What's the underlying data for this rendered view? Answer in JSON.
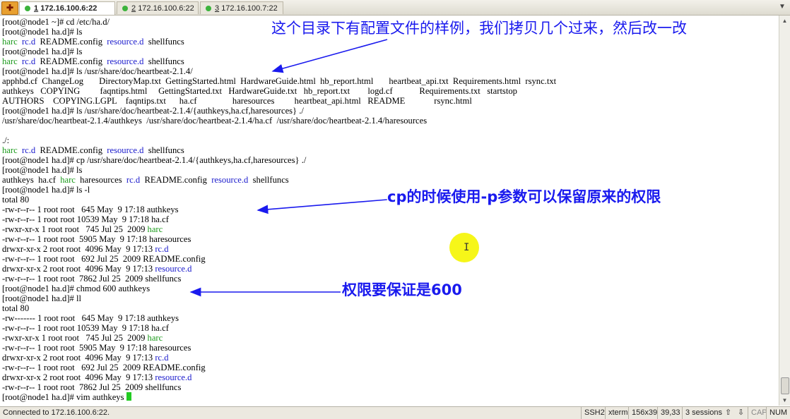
{
  "tabs": [
    {
      "num": "1",
      "host": "172.16.100.6:22"
    },
    {
      "num": "2",
      "host": "172.16.100.6:22"
    },
    {
      "num": "3",
      "host": "172.16.100.7:22"
    }
  ],
  "colors": {
    "executable": "#1a9a1a",
    "directory": "#1a1acc",
    "annotation": "#1a1aee",
    "cursor": "#22cc22",
    "highlight": "#f5f500"
  },
  "terminal_lines": [
    [
      {
        "t": "[root@node1 ~]# cd /etc/ha.d/"
      }
    ],
    [
      {
        "t": "[root@node1 ha.d]# ls"
      }
    ],
    [
      {
        "t": "harc",
        "c": "exec"
      },
      {
        "t": "  "
      },
      {
        "t": "rc.d",
        "c": "dir"
      },
      {
        "t": "  README.config  "
      },
      {
        "t": "resource.d",
        "c": "dir"
      },
      {
        "t": "  shellfuncs"
      }
    ],
    [
      {
        "t": "[root@node1 ha.d]# ls"
      }
    ],
    [
      {
        "t": "harc",
        "c": "exec"
      },
      {
        "t": "  "
      },
      {
        "t": "rc.d",
        "c": "dir"
      },
      {
        "t": "  README.config  "
      },
      {
        "t": "resource.d",
        "c": "dir"
      },
      {
        "t": "  shellfuncs"
      }
    ],
    [
      {
        "t": "[root@node1 ha.d]# ls /usr/share/doc/heartbeat-2.1.4/"
      }
    ],
    [
      {
        "t": "apphbd.cf  ChangeLog       DirectoryMap.txt  GettingStarted.html  HardwareGuide.html  hb_report.html       heartbeat_api.txt  Requirements.html  rsync.txt"
      }
    ],
    [
      {
        "t": "authkeys   COPYING         faqntips.html     GettingStarted.txt   HardwareGuide.txt   hb_report.txt        logd.cf            Requirements.txt   startstop"
      }
    ],
    [
      {
        "t": "AUTHORS    COPYING.LGPL    faqntips.txt      ha.cf                haresources         heartbeat_api.html   README             rsync.html"
      }
    ],
    [
      {
        "t": "[root@node1 ha.d]# ls /usr/share/doc/heartbeat-2.1.4/{authkeys,ha.cf,haresources} ./"
      }
    ],
    [
      {
        "t": "/usr/share/doc/heartbeat-2.1.4/authkeys  /usr/share/doc/heartbeat-2.1.4/ha.cf  /usr/share/doc/heartbeat-2.1.4/haresources"
      }
    ],
    [
      {
        "t": ""
      }
    ],
    [
      {
        "t": "./:"
      }
    ],
    [
      {
        "t": "harc",
        "c": "exec"
      },
      {
        "t": "  "
      },
      {
        "t": "rc.d",
        "c": "dir"
      },
      {
        "t": "  README.config  "
      },
      {
        "t": "resource.d",
        "c": "dir"
      },
      {
        "t": "  shellfuncs"
      }
    ],
    [
      {
        "t": "[root@node1 ha.d]# cp /usr/share/doc/heartbeat-2.1.4/{authkeys,ha.cf,haresources} ./"
      }
    ],
    [
      {
        "t": "[root@node1 ha.d]# ls"
      }
    ],
    [
      {
        "t": "authkeys  ha.cf  "
      },
      {
        "t": "harc",
        "c": "exec"
      },
      {
        "t": "  haresources  "
      },
      {
        "t": "rc.d",
        "c": "dir"
      },
      {
        "t": "  README.config  "
      },
      {
        "t": "resource.d",
        "c": "dir"
      },
      {
        "t": "  shellfuncs"
      }
    ],
    [
      {
        "t": "[root@node1 ha.d]# ls -l"
      }
    ],
    [
      {
        "t": "total 80"
      }
    ],
    [
      {
        "t": "-rw-r--r-- 1 root root   645 May  9 17:18 authkeys"
      }
    ],
    [
      {
        "t": "-rw-r--r-- 1 root root 10539 May  9 17:18 ha.cf"
      }
    ],
    [
      {
        "t": "-rwxr-xr-x 1 root root   745 Jul 25  2009 "
      },
      {
        "t": "harc",
        "c": "exec"
      }
    ],
    [
      {
        "t": "-rw-r--r-- 1 root root  5905 May  9 17:18 haresources"
      }
    ],
    [
      {
        "t": "drwxr-xr-x 2 root root  4096 May  9 17:13 "
      },
      {
        "t": "rc.d",
        "c": "dir"
      }
    ],
    [
      {
        "t": "-rw-r--r-- 1 root root   692 Jul 25  2009 README.config"
      }
    ],
    [
      {
        "t": "drwxr-xr-x 2 root root  4096 May  9 17:13 "
      },
      {
        "t": "resource.d",
        "c": "dir"
      }
    ],
    [
      {
        "t": "-rw-r--r-- 1 root root  7862 Jul 25  2009 shellfuncs"
      }
    ],
    [
      {
        "t": "[root@node1 ha.d]# chmod 600 authkeys"
      }
    ],
    [
      {
        "t": "[root@node1 ha.d]# ll"
      }
    ],
    [
      {
        "t": "total 80"
      }
    ],
    [
      {
        "t": "-rw------- 1 root root   645 May  9 17:18 authkeys"
      }
    ],
    [
      {
        "t": "-rw-r--r-- 1 root root 10539 May  9 17:18 ha.cf"
      }
    ],
    [
      {
        "t": "-rwxr-xr-x 1 root root   745 Jul 25  2009 "
      },
      {
        "t": "harc",
        "c": "exec"
      }
    ],
    [
      {
        "t": "-rw-r--r-- 1 root root  5905 May  9 17:18 haresources"
      }
    ],
    [
      {
        "t": "drwxr-xr-x 2 root root  4096 May  9 17:13 "
      },
      {
        "t": "rc.d",
        "c": "dir"
      }
    ],
    [
      {
        "t": "-rw-r--r-- 1 root root   692 Jul 25  2009 README.config"
      }
    ],
    [
      {
        "t": "drwxr-xr-x 2 root root  4096 May  9 17:13 "
      },
      {
        "t": "resource.d",
        "c": "dir"
      }
    ],
    [
      {
        "t": "-rw-r--r-- 1 root root  7862 Jul 25  2009 shellfuncs"
      }
    ],
    [
      {
        "t": "[root@node1 ha.d]# vim authkeys "
      }
    ]
  ],
  "annotations": {
    "note1": "这个目录下有配置文件的样例，我们拷贝几个过来，然后改一改",
    "note2": "cp的时候使用-p参数可以保留原来的权限",
    "note3": "权限要保证是600"
  },
  "status": {
    "connected": "Connected to 172.16.100.6:22.",
    "protocol": "SSH2",
    "terminal_type": "xterm",
    "size": "156x39",
    "position": "39,33",
    "sessions": "3 sessions",
    "cap": "CAP",
    "num": "NUM"
  }
}
